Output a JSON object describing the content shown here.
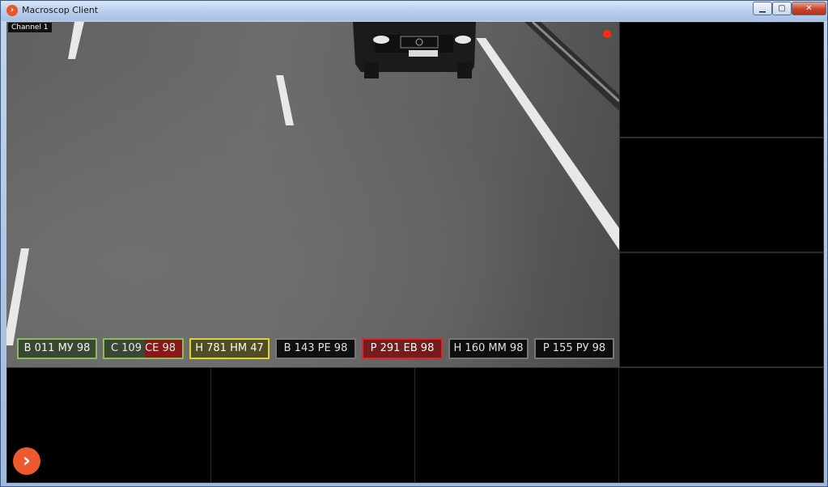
{
  "window": {
    "title": "Macroscop Client",
    "controls": {
      "minimize_glyph": "▁",
      "maximize_glyph": "▢",
      "close_glyph": "✕"
    }
  },
  "main_view": {
    "channel_label": "Channel 1",
    "plates": [
      {
        "text": "В 011 МУ 98",
        "status": "green"
      },
      {
        "text": "С 109 СЕ 98",
        "status": "split"
      },
      {
        "text": "Н 781 НМ 47",
        "status": "yellow"
      },
      {
        "text": "В 143 РЕ 98",
        "status": "neutral"
      },
      {
        "text": "Р 291 ЕВ 98",
        "status": "red"
      },
      {
        "text": "Н 160 ММ 98",
        "status": "neutral"
      },
      {
        "text": "Р 155 РУ 98",
        "status": "neutral"
      }
    ]
  },
  "logo": {
    "glyph": "›",
    "icon": "macroscop-logo-icon"
  },
  "colors": {
    "accent": "#ee5a2f",
    "record": "#ff2a0a",
    "plate_green": "#8dbb5a",
    "plate_yellow": "#e0d42c",
    "plate_red": "#d8282a"
  }
}
